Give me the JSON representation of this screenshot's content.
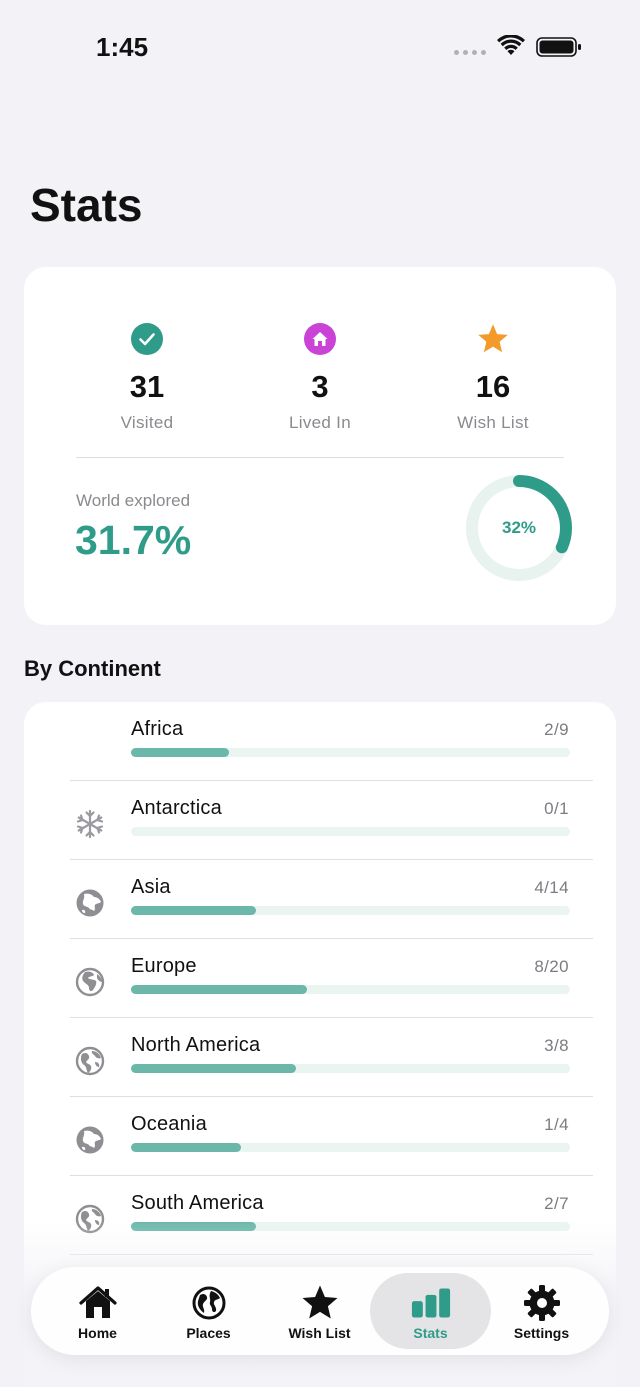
{
  "status_bar": {
    "time": "1:45"
  },
  "page": {
    "title": "Stats"
  },
  "summary": {
    "visited": {
      "value": "31",
      "label": "Visited",
      "icon": "checkmark-circle-icon",
      "color": "#2f9c89"
    },
    "lived_in": {
      "value": "3",
      "label": "Lived In",
      "icon": "house-circle-icon",
      "color": "#c944d6"
    },
    "wish_list": {
      "value": "16",
      "label": "Wish List",
      "icon": "star-icon",
      "color": "#f39a2b"
    },
    "world_explored_label": "World explored",
    "world_explored_value": "31.7%",
    "ring_label": "32%",
    "ring_fraction": 0.317,
    "accent_color": "#2f9c89"
  },
  "by_continent": {
    "title": "By Continent",
    "rows": [
      {
        "name": "Africa",
        "count": "2/9",
        "visited": 2,
        "total": 9,
        "icon": "none"
      },
      {
        "name": "Antarctica",
        "count": "0/1",
        "visited": 0,
        "total": 1,
        "icon": "snowflake-icon"
      },
      {
        "name": "Asia",
        "count": "4/14",
        "visited": 4,
        "total": 14,
        "icon": "globe-asia-icon"
      },
      {
        "name": "Europe",
        "count": "8/20",
        "visited": 8,
        "total": 20,
        "icon": "globe-europe-africa-icon"
      },
      {
        "name": "North America",
        "count": "3/8",
        "visited": 3,
        "total": 8,
        "icon": "globe-americas-icon"
      },
      {
        "name": "Oceania",
        "count": "1/4",
        "visited": 1,
        "total": 4,
        "icon": "globe-asia-icon"
      },
      {
        "name": "South America",
        "count": "2/7",
        "visited": 2,
        "total": 7,
        "icon": "globe-americas-icon"
      }
    ]
  },
  "tab_bar": {
    "items": [
      {
        "label": "Home",
        "icon": "house-icon",
        "selected": false
      },
      {
        "label": "Places",
        "icon": "globe-icon",
        "selected": false
      },
      {
        "label": "Wish List",
        "icon": "star-icon",
        "selected": false
      },
      {
        "label": "Stats",
        "icon": "bar-chart-icon",
        "selected": true
      },
      {
        "label": "Settings",
        "icon": "gear-icon",
        "selected": false
      }
    ],
    "selected_color": "#2f9c89"
  }
}
